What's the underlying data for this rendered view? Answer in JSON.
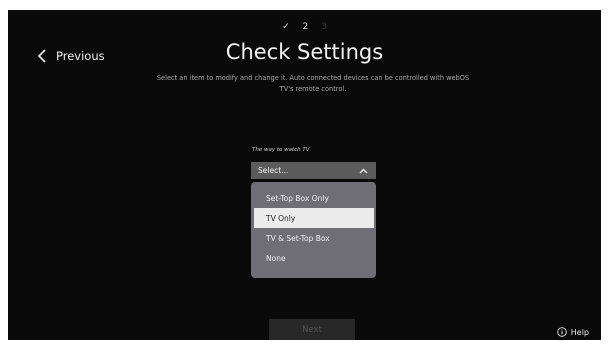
{
  "steps": {
    "done_mark": "✓",
    "current": "2",
    "next": "3"
  },
  "nav": {
    "previous_label": "Previous"
  },
  "header": {
    "title": "Check Settings",
    "subtitle_line1": "Select an item to modify and change it. Auto connected devices can be controlled with webOS",
    "subtitle_line2": "TV's remote control."
  },
  "field": {
    "label": "The way to watch TV",
    "value": "Select...",
    "options": [
      {
        "label": "Set-Top Box Only"
      },
      {
        "label": "TV Only"
      },
      {
        "label": "TV & Set-Top Box"
      },
      {
        "label": "None"
      }
    ],
    "highlighted_option": "TV Only"
  },
  "footer": {
    "next_label": "Next",
    "help_label": "Help"
  },
  "icons": {
    "previous": "chevron-left-icon",
    "select_toggle": "chevron-up-icon",
    "help": "info-circle-icon",
    "step_done": "checkmark-icon"
  },
  "colors": {
    "background": "#0a0a0a",
    "select_bg": "#5b5b5b",
    "dropdown_bg": "#6e6e74",
    "highlight_bg": "#ececec",
    "next_disabled_bg": "#282828"
  }
}
